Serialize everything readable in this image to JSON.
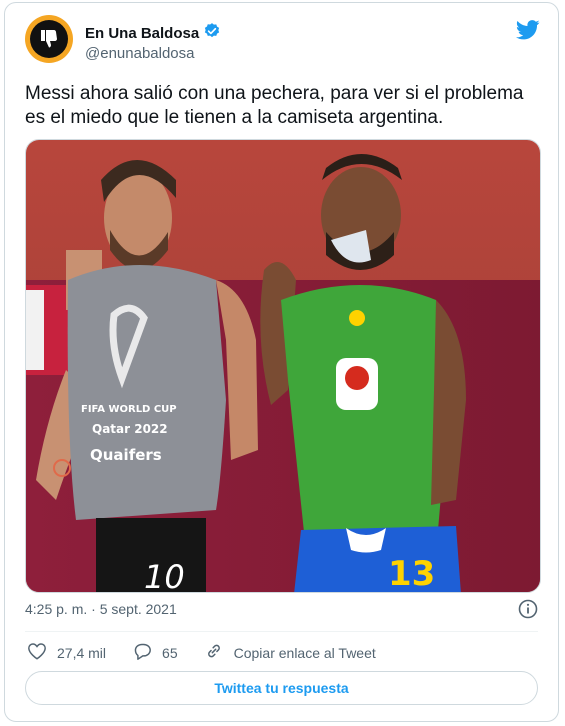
{
  "account": {
    "name": "En Una Baldosa",
    "handle": "@enunabaldosa",
    "verified": true,
    "avatar_icon": "thumbs-down-icon"
  },
  "tweet": {
    "text": "Messi ahora salió con una pechera, para ver si el problema es el miedo que le tienen a la camiseta argentina.",
    "timestamp": "4:25 p. m. · 5 sept. 2021"
  },
  "media": {
    "bib_badge": "FIFA WORLD CUP",
    "bib_event": "Qatar 2022",
    "bib_text": "Quaifers",
    "left_number": "10",
    "right_number": "13"
  },
  "actions": {
    "likes": "27,4 mil",
    "replies": "65",
    "copy_link": "Copiar enlace al Tweet"
  },
  "reply_button": "Twittea tu respuesta",
  "colors": {
    "accent": "#1d9bf0",
    "avatar": "#f5a623",
    "jersey_green": "#3fa63a",
    "shorts_blue": "#1e5fd6",
    "bib_gray": "#8d9097"
  }
}
